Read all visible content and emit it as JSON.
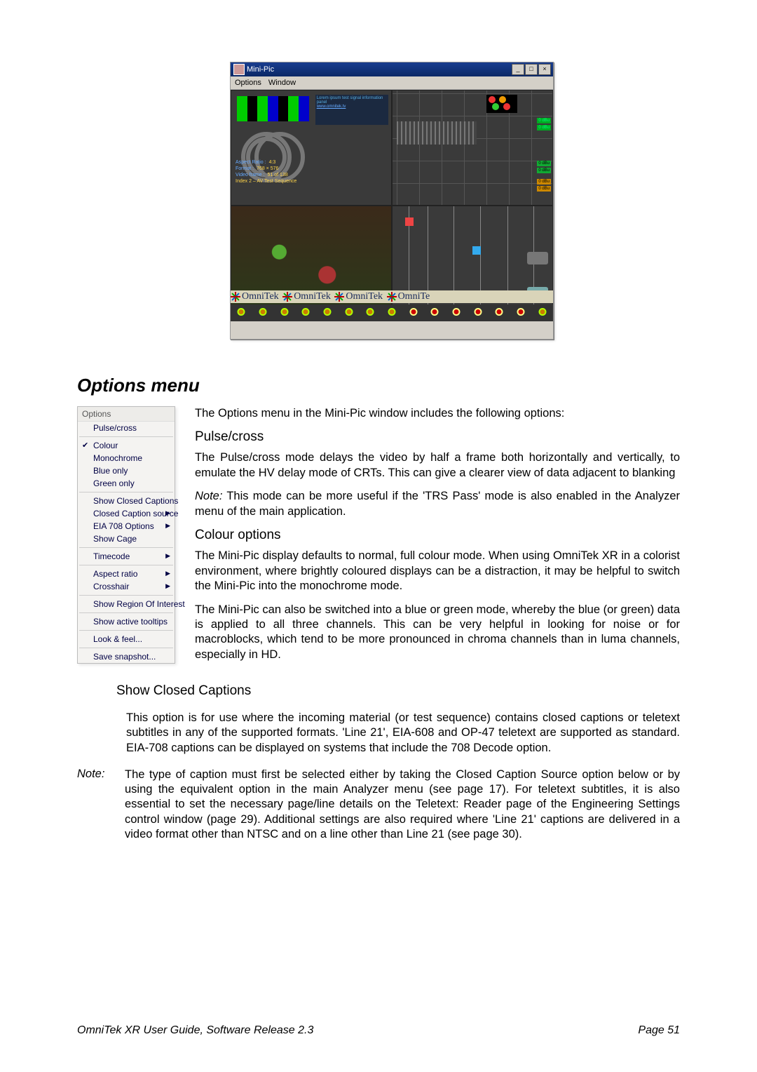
{
  "window": {
    "title": "Mini-Pic",
    "menus": [
      "Options",
      "Window"
    ],
    "win_min": "_",
    "win_max": "□",
    "win_close": "×"
  },
  "overlay_info": {
    "line1_label": "Aspect Ratio :",
    "line1_val": "4:3",
    "line2_label": "Format :",
    "line2_val": "768 × 576",
    "line3_label": "Video frame :",
    "line3_val": "51 of 138",
    "line4": "Index 2 – AV Test Sequence"
  },
  "badges": [
    "0 dBu",
    "0 dBu",
    "0 dBu",
    "0 dBu",
    "0 dBu",
    "0 dBu"
  ],
  "watermark_text": "OmniTek",
  "section_heading": "Options menu",
  "options_menu": {
    "header": "Options",
    "pulse_cross": "Pulse/cross",
    "colour": "Colour",
    "mono": "Monochrome",
    "blue": "Blue only",
    "green": "Green only",
    "showcc": "Show Closed Captions",
    "cc_source": "Closed Caption source",
    "eia708": "EIA 708 Options",
    "cage": "Show Cage",
    "timecode": "Timecode",
    "aspect": "Aspect ratio",
    "crosshair": "Crosshair",
    "roi": "Show Region Of Interest",
    "tooltips": "Show active tooltips",
    "look": "Look & feel...",
    "snapshot": "Save snapshot..."
  },
  "body": {
    "intro": "The Options menu in the Mini-Pic window includes the following options:",
    "pulse_h": "Pulse/cross",
    "pulse_p1": "The Pulse/cross mode delays the video by half a frame both horizontally and vertically, to emulate the HV delay mode of CRTs. This can give a clearer view of data adjacent to blanking",
    "pulse_note_label": "Note:",
    "pulse_note": " This mode can be more useful if the 'TRS Pass' mode is also enabled in the Analyzer menu of the main application.",
    "colour_h": "Colour options",
    "colour_p1": "The Mini-Pic display defaults to normal, full colour mode. When using OmniTek XR in a colorist environment, where brightly coloured displays can be a distraction, it may be helpful to switch the Mini-Pic into the monochrome mode.",
    "colour_p2": "The Mini-Pic can also be switched into a blue or green mode, whereby the blue (or green) data is applied to all three channels. This can be very helpful in looking for noise or for macroblocks, which tend to be more pronounced in chroma channels than in luma channels, especially in HD.",
    "scc_h": "Show Closed Captions",
    "scc_p1": "This option is for use where the incoming material (or test sequence) contains closed captions or teletext subtitles in any of the supported formats. 'Line 21', EIA-608 and OP-47 teletext are supported as standard. EIA-708 captions can be displayed on systems that include the 708 Decode option.",
    "scc_note_label": "Note:",
    "scc_note": "The type of caption must first be selected either by taking the Closed Caption Source option below or by using the equivalent option in the main Analyzer menu (see page 17). For teletext subtitles, it is also essential to set the necessary page/line details on the Teletext: Reader page of the Engineering Settings control window (page 29). Additional settings are also required where 'Line 21' captions are delivered in a video format other than NTSC and on a line other than Line 21 (see page 30)."
  },
  "footer_left": "OmniTek XR User Guide, Software Release 2.3",
  "footer_right": "Page 51"
}
